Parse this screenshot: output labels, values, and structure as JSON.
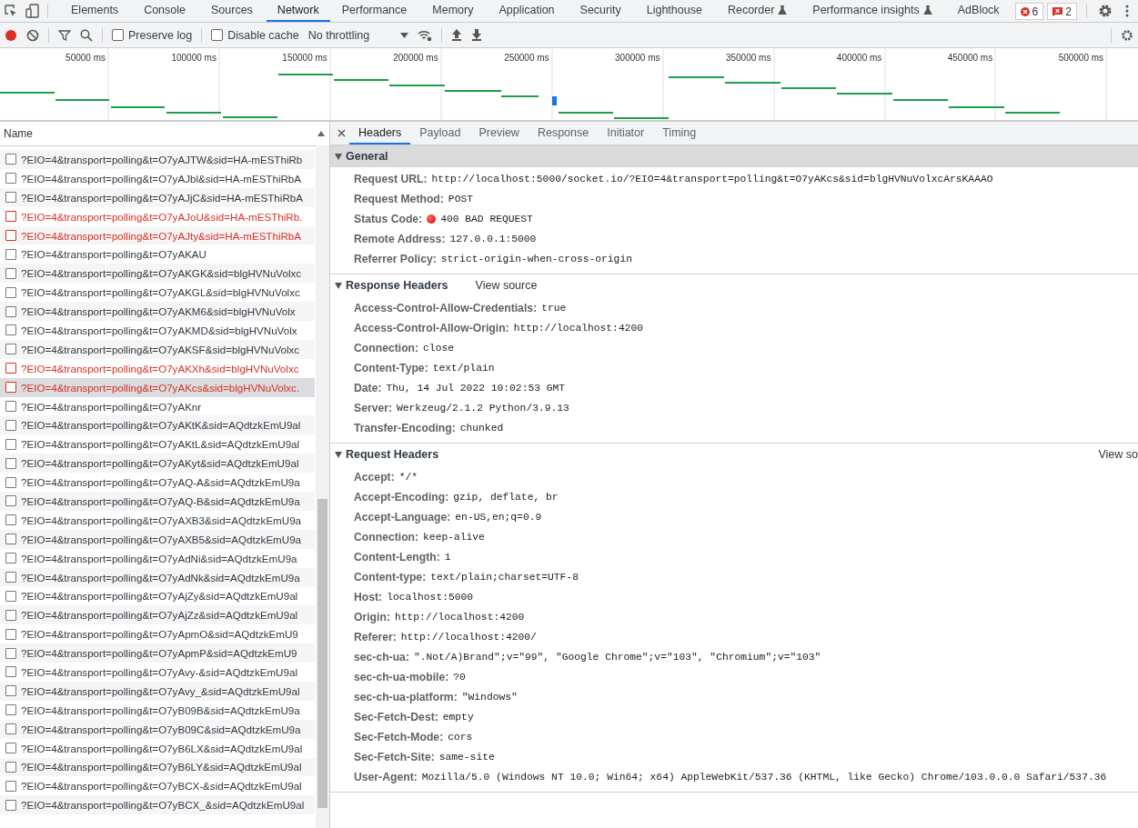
{
  "devtools_tabs": [
    {
      "label": "Elements",
      "selected": false,
      "experimental": false
    },
    {
      "label": "Console",
      "selected": false,
      "experimental": false
    },
    {
      "label": "Sources",
      "selected": false,
      "experimental": false
    },
    {
      "label": "Network",
      "selected": true,
      "experimental": false
    },
    {
      "label": "Performance",
      "selected": false,
      "experimental": false
    },
    {
      "label": "Memory",
      "selected": false,
      "experimental": false
    },
    {
      "label": "Application",
      "selected": false,
      "experimental": false
    },
    {
      "label": "Security",
      "selected": false,
      "experimental": false
    },
    {
      "label": "Lighthouse",
      "selected": false,
      "experimental": false
    },
    {
      "label": "Recorder",
      "selected": false,
      "experimental": true
    },
    {
      "label": "Performance insights",
      "selected": false,
      "experimental": true
    },
    {
      "label": "AdBlock",
      "selected": false,
      "experimental": false
    }
  ],
  "error_count": "6",
  "issue_count": "2",
  "toolbar": {
    "recording": true,
    "preserve_log": {
      "label": "Preserve log",
      "checked": false
    },
    "disable_cache": {
      "label": "Disable cache",
      "checked": false
    },
    "throttling": "No throttling"
  },
  "timeline_ticks": [
    "50000 ms",
    "100000 ms",
    "150000 ms",
    "200000 ms",
    "250000 ms",
    "300000 ms",
    "350000 ms",
    "400000 ms",
    "450000 ms",
    "500000 ms"
  ],
  "name_column": "Name",
  "requests": [
    {
      "name": "?EIO=4&transport=polling&t=O7yAJTW&sid=HA-mESThiRb",
      "error": false,
      "selected": false
    },
    {
      "name": "?EIO=4&transport=polling&t=O7yAJbl&sid=HA-mESThiRbA",
      "error": false,
      "selected": false
    },
    {
      "name": "?EIO=4&transport=polling&t=O7yAJjC&sid=HA-mESThiRbA",
      "error": false,
      "selected": false
    },
    {
      "name": "?EIO=4&transport=polling&t=O7yAJoU&sid=HA-mESThiRb.",
      "error": true,
      "selected": false
    },
    {
      "name": "?EIO=4&transport=polling&t=O7yAJty&sid=HA-mESThiRbA",
      "error": true,
      "selected": false
    },
    {
      "name": "?EIO=4&transport=polling&t=O7yAKAU",
      "error": false,
      "selected": false
    },
    {
      "name": "?EIO=4&transport=polling&t=O7yAKGK&sid=blgHVNuVolxc",
      "error": false,
      "selected": false
    },
    {
      "name": "?EIO=4&transport=polling&t=O7yAKGL&sid=blgHVNuVolxc",
      "error": false,
      "selected": false
    },
    {
      "name": "?EIO=4&transport=polling&t=O7yAKM6&sid=blgHVNuVolx",
      "error": false,
      "selected": false
    },
    {
      "name": "?EIO=4&transport=polling&t=O7yAKMD&sid=blgHVNuVolx",
      "error": false,
      "selected": false
    },
    {
      "name": "?EIO=4&transport=polling&t=O7yAKSF&sid=blgHVNuVolxc",
      "error": false,
      "selected": false
    },
    {
      "name": "?EIO=4&transport=polling&t=O7yAKXh&sid=blgHVNuVolxc",
      "error": true,
      "selected": false
    },
    {
      "name": "?EIO=4&transport=polling&t=O7yAKcs&sid=blgHVNuVolxc.",
      "error": true,
      "selected": true
    },
    {
      "name": "?EIO=4&transport=polling&t=O7yAKnr",
      "error": false,
      "selected": false
    },
    {
      "name": "?EIO=4&transport=polling&t=O7yAKtK&sid=AQdtzkEmU9al",
      "error": false,
      "selected": false
    },
    {
      "name": "?EIO=4&transport=polling&t=O7yAKtL&sid=AQdtzkEmU9al",
      "error": false,
      "selected": false
    },
    {
      "name": "?EIO=4&transport=polling&t=O7yAKyt&sid=AQdtzkEmU9al",
      "error": false,
      "selected": false
    },
    {
      "name": "?EIO=4&transport=polling&t=O7yAQ-A&sid=AQdtzkEmU9a",
      "error": false,
      "selected": false
    },
    {
      "name": "?EIO=4&transport=polling&t=O7yAQ-B&sid=AQdtzkEmU9a",
      "error": false,
      "selected": false
    },
    {
      "name": "?EIO=4&transport=polling&t=O7yAXB3&sid=AQdtzkEmU9a",
      "error": false,
      "selected": false
    },
    {
      "name": "?EIO=4&transport=polling&t=O7yAXB5&sid=AQdtzkEmU9a",
      "error": false,
      "selected": false
    },
    {
      "name": "?EIO=4&transport=polling&t=O7yAdNi&sid=AQdtzkEmU9a",
      "error": false,
      "selected": false
    },
    {
      "name": "?EIO=4&transport=polling&t=O7yAdNk&sid=AQdtzkEmU9a",
      "error": false,
      "selected": false
    },
    {
      "name": "?EIO=4&transport=polling&t=O7yAjZy&sid=AQdtzkEmU9al",
      "error": false,
      "selected": false
    },
    {
      "name": "?EIO=4&transport=polling&t=O7yAjZz&sid=AQdtzkEmU9al",
      "error": false,
      "selected": false
    },
    {
      "name": "?EIO=4&transport=polling&t=O7yApmO&sid=AQdtzkEmU9",
      "error": false,
      "selected": false
    },
    {
      "name": "?EIO=4&transport=polling&t=O7yApmP&sid=AQdtzkEmU9",
      "error": false,
      "selected": false
    },
    {
      "name": "?EIO=4&transport=polling&t=O7yAvy-&sid=AQdtzkEmU9al",
      "error": false,
      "selected": false
    },
    {
      "name": "?EIO=4&transport=polling&t=O7yAvy_&sid=AQdtzkEmU9al",
      "error": false,
      "selected": false
    },
    {
      "name": "?EIO=4&transport=polling&t=O7yB09B&sid=AQdtzkEmU9a",
      "error": false,
      "selected": false
    },
    {
      "name": "?EIO=4&transport=polling&t=O7yB09C&sid=AQdtzkEmU9a",
      "error": false,
      "selected": false
    },
    {
      "name": "?EIO=4&transport=polling&t=O7yB6LX&sid=AQdtzkEmU9al",
      "error": false,
      "selected": false
    },
    {
      "name": "?EIO=4&transport=polling&t=O7yB6LY&sid=AQdtzkEmU9al",
      "error": false,
      "selected": false
    },
    {
      "name": "?EIO=4&transport=polling&t=O7yBCX-&sid=AQdtzkEmU9al",
      "error": false,
      "selected": false
    },
    {
      "name": "?EIO=4&transport=polling&t=O7yBCX_&sid=AQdtzkEmU9al",
      "error": false,
      "selected": false
    }
  ],
  "detail_tabs": [
    {
      "label": "Headers",
      "selected": true
    },
    {
      "label": "Payload",
      "selected": false
    },
    {
      "label": "Preview",
      "selected": false
    },
    {
      "label": "Response",
      "selected": false
    },
    {
      "label": "Initiator",
      "selected": false
    },
    {
      "label": "Timing",
      "selected": false
    }
  ],
  "sections": [
    {
      "title": "General",
      "highlighted": true,
      "rows": [
        {
          "kind": "plain",
          "name": "Request URL:",
          "value": "http://localhost:5000/socket.io/?EIO=4&transport=polling&t=O7yAKcs&sid=blgHVNuVolxcArsKAAAO"
        },
        {
          "kind": "plain",
          "name": "Request Method:",
          "value": "POST"
        },
        {
          "kind": "status",
          "name": "Status Code:",
          "value": "400 BAD REQUEST"
        },
        {
          "kind": "plain",
          "name": "Remote Address:",
          "value": "127.0.0.1:5000"
        },
        {
          "kind": "plain",
          "name": "Referrer Policy:",
          "value": "strict-origin-when-cross-origin"
        }
      ]
    },
    {
      "title": "Response Headers",
      "highlighted": false,
      "link": "View source",
      "rows": [
        {
          "kind": "plain",
          "name": "Access-Control-Allow-Credentials:",
          "value": "true"
        },
        {
          "kind": "plain",
          "name": "Access-Control-Allow-Origin:",
          "value": "http://localhost:4200"
        },
        {
          "kind": "plain",
          "name": "Connection:",
          "value": "close"
        },
        {
          "kind": "plain",
          "name": "Content-Type:",
          "value": "text/plain"
        },
        {
          "kind": "plain",
          "name": "Date:",
          "value": "Thu, 14 Jul 2022 10:02:53 GMT"
        },
        {
          "kind": "plain",
          "name": "Server:",
          "value": "Werkzeug/2.1.2 Python/3.9.13"
        },
        {
          "kind": "plain",
          "name": "Transfer-Encoding:",
          "value": "chunked"
        }
      ]
    },
    {
      "title": "Request Headers",
      "highlighted": false,
      "link_right": "View so",
      "rows": [
        {
          "kind": "plain",
          "name": "Accept:",
          "value": "*/*"
        },
        {
          "kind": "plain",
          "name": "Accept-Encoding:",
          "value": "gzip, deflate, br"
        },
        {
          "kind": "plain",
          "name": "Accept-Language:",
          "value": "en-US,en;q=0.9"
        },
        {
          "kind": "plain",
          "name": "Connection:",
          "value": "keep-alive"
        },
        {
          "kind": "plain",
          "name": "Content-Length:",
          "value": "1"
        },
        {
          "kind": "plain",
          "name": "Content-type:",
          "value": "text/plain;charset=UTF-8"
        },
        {
          "kind": "plain",
          "name": "Host:",
          "value": "localhost:5000"
        },
        {
          "kind": "plain",
          "name": "Origin:",
          "value": "http://localhost:4200"
        },
        {
          "kind": "plain",
          "name": "Referer:",
          "value": "http://localhost:4200/"
        },
        {
          "kind": "plain",
          "name": "sec-ch-ua:",
          "value": "\".Not/A)Brand\";v=\"99\", \"Google Chrome\";v=\"103\", \"Chromium\";v=\"103\""
        },
        {
          "kind": "plain",
          "name": "sec-ch-ua-mobile:",
          "value": "?0"
        },
        {
          "kind": "plain",
          "name": "sec-ch-ua-platform:",
          "value": "\"Windows\""
        },
        {
          "kind": "plain",
          "name": "Sec-Fetch-Dest:",
          "value": "empty"
        },
        {
          "kind": "plain",
          "name": "Sec-Fetch-Mode:",
          "value": "cors"
        },
        {
          "kind": "plain",
          "name": "Sec-Fetch-Site:",
          "value": "same-site"
        },
        {
          "kind": "plain",
          "name": "User-Agent:",
          "value": "Mozilla/5.0 (Windows NT 10.0; Win64; x64) AppleWebKit/537.36 (KHTML, like Gecko) Chrome/103.0.0.0 Safari/537.36"
        }
      ]
    }
  ]
}
